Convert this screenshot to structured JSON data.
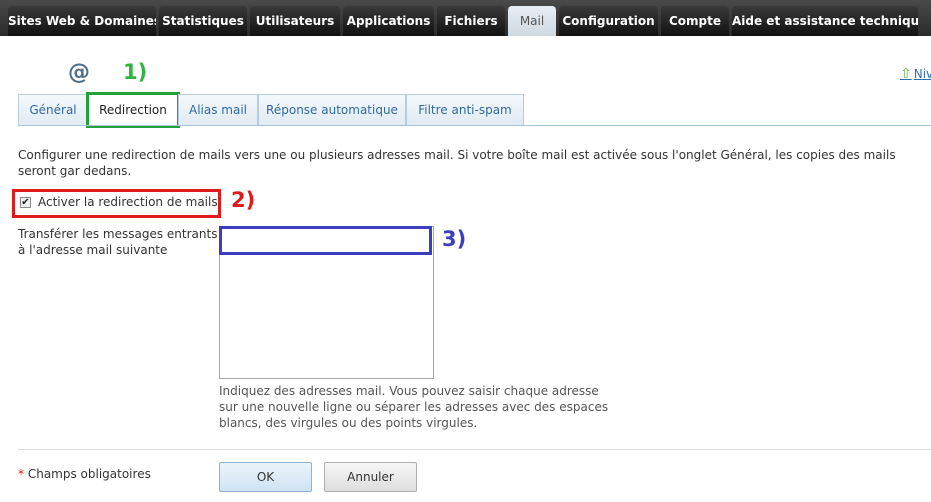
{
  "topnav": {
    "items": [
      {
        "label": "Sites Web & Domaines"
      },
      {
        "label": "Statistiques"
      },
      {
        "label": "Utilisateurs"
      },
      {
        "label": "Applications"
      },
      {
        "label": "Fichiers"
      },
      {
        "label": "Mail"
      },
      {
        "label": "Configuration"
      },
      {
        "label": "Compte"
      },
      {
        "label": "Aide et assistance technique"
      }
    ],
    "active": "Mail"
  },
  "header": {
    "icon": "at-icon",
    "icon_glyph": "@",
    "up_link": "Niv"
  },
  "annotations": {
    "a1": "1)",
    "a2": "2)",
    "a3": "3)"
  },
  "tabs": [
    {
      "label": "Général"
    },
    {
      "label": "Redirection"
    },
    {
      "label": "Alias mail"
    },
    {
      "label": "Réponse automatique"
    },
    {
      "label": "Filtre anti-spam"
    }
  ],
  "active_tab": "Redirection",
  "form": {
    "description": "Configurer une redirection de mails vers une ou plusieurs adresses mail. Si votre boîte mail est activée sous l'onglet Général, les copies des mails seront gar dedans.",
    "enable_label": "Activer la redirection de mails",
    "enable_checked": true,
    "forward_label": "Transférer les messages entrants à l'adresse mail suivante",
    "forward_value": "",
    "hint": "Indiquez des adresses mail. Vous pouvez saisir chaque adresse sur une nouvelle ligne ou séparer les adresses avec des espaces blancs, des virgules ou des points virgules.",
    "required_star": "*",
    "required_label": "Champs obligatoires",
    "ok_label": "OK",
    "cancel_label": "Annuler"
  },
  "colors": {
    "anno1": "#2fb53f",
    "anno2": "#e01a1a",
    "anno3": "#3b3fbf",
    "link": "#2f6aa3"
  }
}
